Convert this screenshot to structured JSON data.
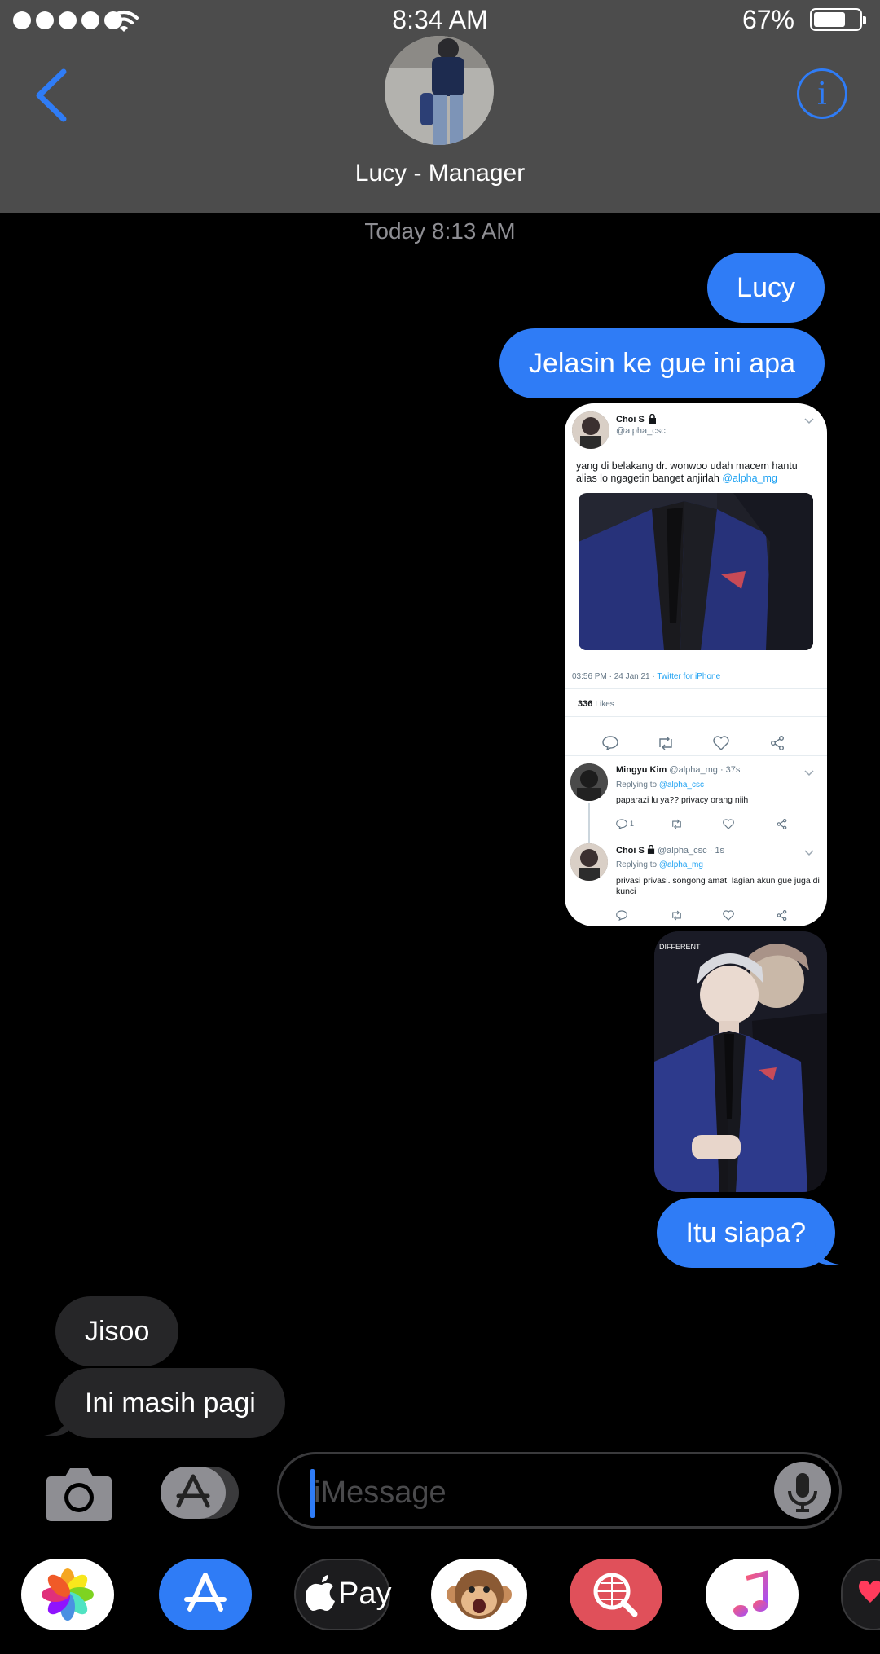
{
  "status_bar": {
    "time": "8:34 AM",
    "battery": "67%",
    "battery_level": 0.67
  },
  "header": {
    "contact_name": "Lucy - Manager",
    "back_icon": "chevron-left-icon",
    "info_icon": "info-icon"
  },
  "timestamp": "Today 8:13 AM",
  "messages": [
    {
      "direction": "out",
      "text": "Lucy"
    },
    {
      "direction": "out",
      "text": "Jelasin ke gue ini apa"
    },
    {
      "direction": "out",
      "text": "Itu siapa?"
    },
    {
      "direction": "in",
      "text": "Jisoo"
    },
    {
      "direction": "in",
      "text": "Ini masih pagi"
    }
  ],
  "tweet": {
    "author_name": "Choi S",
    "author_handle": "@alpha_csc",
    "text": "yang di belakang dr. wonwoo udah macem hantu alias lo ngagetin banget anjirlah",
    "mention": "@alpha_mg",
    "meta_time": "03:56 PM · 24 Jan 21 · ",
    "meta_source": "Twitter for iPhone",
    "likes_count": "336",
    "likes_label": "Likes",
    "replies": [
      {
        "author_name": "Mingyu Kim",
        "meta": "@alpha_mg · 37s",
        "replying_label": "Replying to",
        "replying_to": "@alpha_csc",
        "text": "paparazi lu ya?? privacy orang niih",
        "reply_count": "1"
      },
      {
        "author_name": "Choi S",
        "meta": "@alpha_csc · 1s",
        "replying_label": "Replying to",
        "replying_to": "@alpha_mg",
        "text": "privasi privasi. songong amat. lagian akun gue juga di kunci",
        "reply_count": ""
      }
    ]
  },
  "photo_watermark": "DIFFERENT",
  "input": {
    "placeholder": "iMessage"
  },
  "app_tray": [
    {
      "name": "photos-app-icon"
    },
    {
      "name": "app-store-icon"
    },
    {
      "name": "apple-pay-icon",
      "label": "Pay"
    },
    {
      "name": "animoji-monkey-icon"
    },
    {
      "name": "image-search-icon"
    },
    {
      "name": "music-icon"
    },
    {
      "name": "digital-touch-icon"
    }
  ],
  "colors": {
    "accent": "#2f7cf6",
    "header_bg": "#4c4c4c",
    "incoming_bubble": "#262628",
    "background": "#000000"
  }
}
